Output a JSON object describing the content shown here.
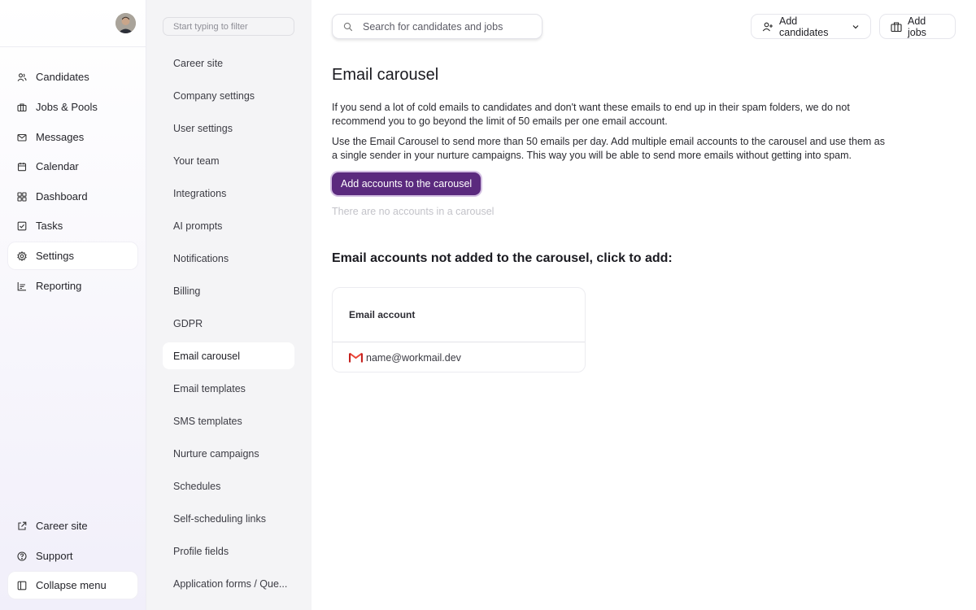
{
  "nav": {
    "items": [
      {
        "label": "Candidates",
        "icon": "users-icon"
      },
      {
        "label": "Jobs & Pools",
        "icon": "briefcase-icon"
      },
      {
        "label": "Messages",
        "icon": "mail-icon"
      },
      {
        "label": "Calendar",
        "icon": "calendar-icon"
      },
      {
        "label": "Dashboard",
        "icon": "dashboard-icon"
      },
      {
        "label": "Tasks",
        "icon": "task-check-icon"
      },
      {
        "label": "Settings",
        "icon": "gear-icon"
      },
      {
        "label": "Reporting",
        "icon": "chart-icon"
      }
    ],
    "bottom": [
      {
        "label": "Career site",
        "icon": "external-link-icon"
      },
      {
        "label": "Support",
        "icon": "help-icon"
      },
      {
        "label": "Collapse menu",
        "icon": "sidebar-collapse-icon"
      }
    ],
    "active": "Settings"
  },
  "settings": {
    "filter_placeholder": "Start typing to filter",
    "items": [
      "Career site",
      "Company settings",
      "User settings",
      "Your team",
      "Integrations",
      "AI prompts",
      "Notifications",
      "Billing",
      "GDPR",
      "Email carousel",
      "Email templates",
      "SMS templates",
      "Nurture campaigns",
      "Schedules",
      "Self-scheduling links",
      "Profile fields",
      "Application forms / Que..."
    ],
    "active": "Email carousel"
  },
  "header": {
    "search_placeholder": "Search for candidates and jobs",
    "add_candidates_label": "Add candidates",
    "add_jobs_label": "Add jobs"
  },
  "page": {
    "title": "Email carousel",
    "paragraph1": "If you send a lot of cold emails to candidates and don't want these emails to end up in their spam folders, we do not recommend you to go beyond the limit of 50 emails per one email account.",
    "paragraph2": "Use the Email Carousel to send more than 50 emails per day. Add multiple email accounts to the carousel and use them as a single sender in your nurture campaigns. This way you will be able to send more emails without getting into spam.",
    "add_button_label": "Add accounts to the carousel",
    "empty_note": "There are no accounts in a carousel",
    "section_title": "Email accounts not added to the carousel, click to add:",
    "table": {
      "header": "Email account",
      "rows": [
        {
          "email": "name@workmail.dev",
          "icon": "gmail-icon"
        }
      ]
    }
  },
  "colors": {
    "accent": "#5b2a7e",
    "accent_ring": "#d3bfe2",
    "gmail_red": "#ea4335"
  }
}
